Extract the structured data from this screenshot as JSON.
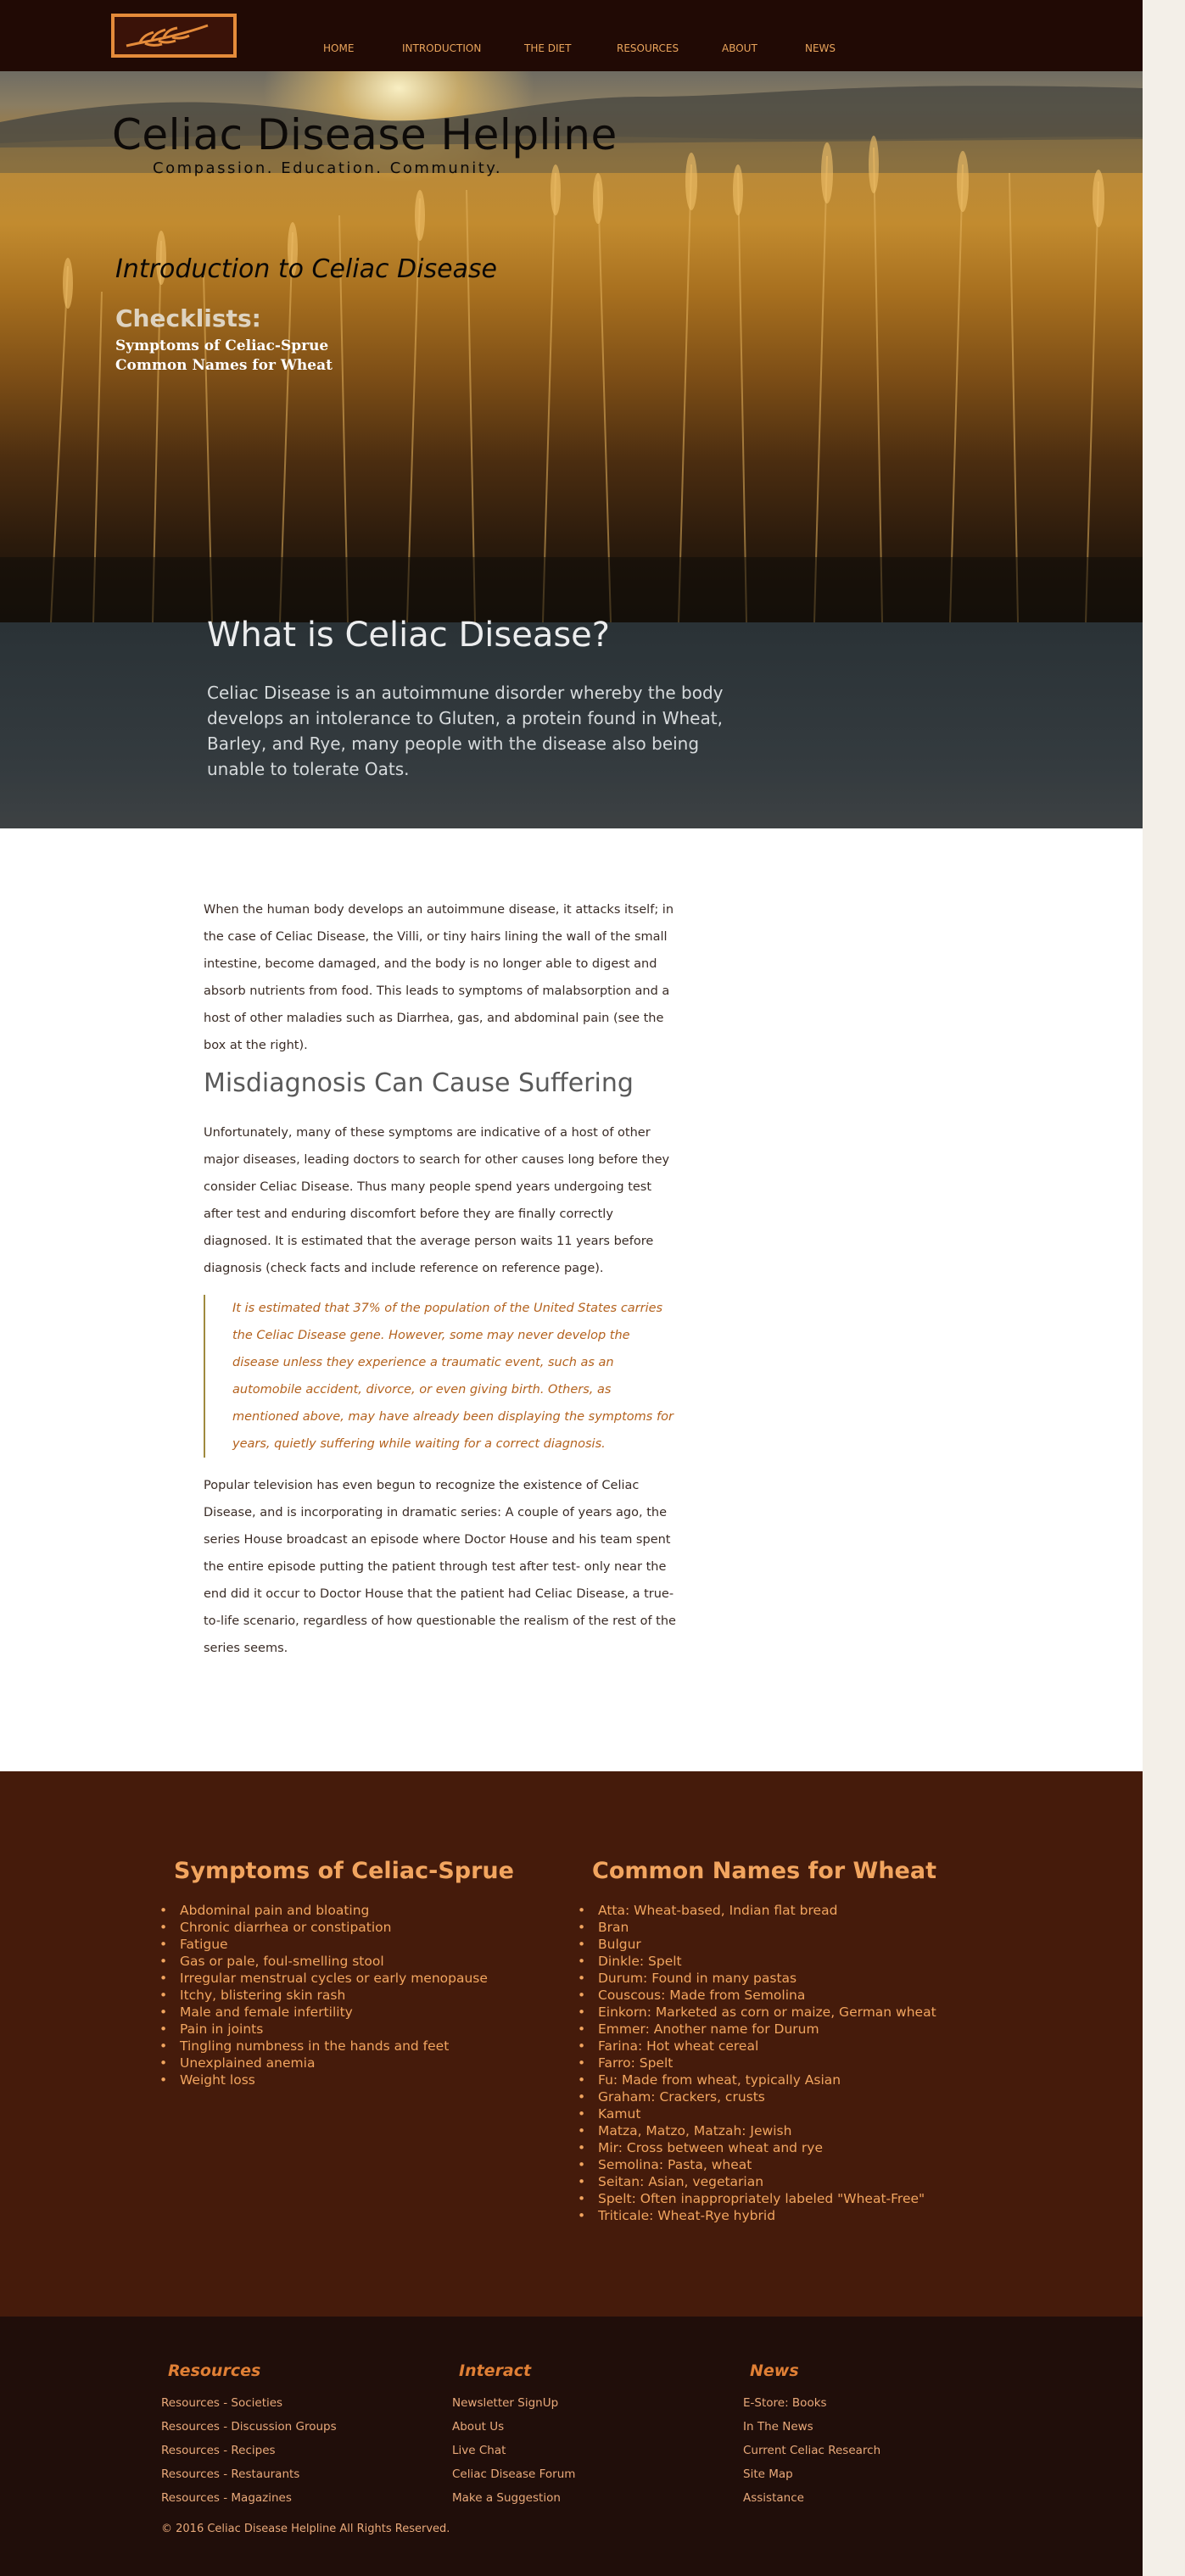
{
  "nav": {
    "items": [
      "HOME",
      "INTRODUCTION",
      "THE DIET",
      "RESOURCES",
      "ABOUT",
      "NEWS"
    ]
  },
  "hero": {
    "title": "Celiac Disease Helpline",
    "tagline": "Compassion. Education. Community.",
    "intro_link": "Introduction to Celiac Disease",
    "checklists_heading": "Checklists:",
    "checklist_links": [
      "Symptoms of Celiac-Sprue",
      "Common Names for Wheat"
    ]
  },
  "whatis": {
    "heading": "What is Celiac Disease?",
    "body": "Celiac Disease is an autoimmune disorder whereby the body develops an intolerance to Gluten, a protein found in Wheat, Barley, and Rye, many people with the disease also being unable to tolerate Oats."
  },
  "article": {
    "para1": "When the human body develops an autoimmune disease, it attacks itself; in the case of Celiac Disease, the Villi, or tiny hairs lining the wall of the small intestine, become damaged, and the body is no longer able to digest and absorb nutrients from food. This leads to symptoms of malabsorption and a host of other maladies such as Diarrhea, gas, and abdominal pain (see the box at the right).",
    "subheading": "Misdiagnosis Can Cause Suffering",
    "para2": "Unfortunately, many of these symptoms are indicative of a host of other major diseases, leading doctors to search for other causes long before they consider Celiac Disease. Thus many people spend years undergoing test after test and enduring discomfort before they are finally correctly diagnosed. It is estimated that the average person waits 11 years before diagnosis (check facts and include reference on reference page).",
    "quote": "It is estimated that 37% of the population of the United States carries the Celiac Disease gene. However, some may never develop the disease unless they experience a traumatic event, such as an automobile accident, divorce, or even giving birth. Others, as mentioned above, may have already been displaying the symptoms for years, quietly suffering while waiting for a correct diagnosis.",
    "para3": "Popular television has even begun to recognize the existence of Celiac Disease, and is incorporating in dramatic series: A couple of years ago, the series House broadcast an episode where Doctor House and his team spent the entire episode putting the patient through test after test- only near the end did it occur to Doctor House that the patient had Celiac Disease, a true-to-life scenario, regardless of how questionable the realism of the rest of the series seems."
  },
  "symptoms": {
    "title": "Symptoms of Celiac-Sprue",
    "items": [
      "Abdominal pain and bloating",
      "Chronic diarrhea or constipation",
      "Fatigue",
      "Gas or pale, foul-smelling stool",
      "Irregular menstrual cycles or early menopause",
      "Itchy, blistering skin rash",
      "Male and female infertility",
      "Pain in joints",
      "Tingling numbness in the hands and feet",
      "Unexplained anemia",
      "Weight loss"
    ]
  },
  "wheat": {
    "title": "Common Names for Wheat",
    "items": [
      "Atta: Wheat-based, Indian flat bread",
      "Bran",
      "Bulgur",
      "Dinkle: Spelt",
      "Durum: Found in many pastas",
      "Couscous: Made from Semolina",
      "Einkorn: Marketed as corn or maize, German wheat",
      "Emmer: Another name for Durum",
      "Farina: Hot wheat cereal",
      "Farro: Spelt",
      "Fu: Made from wheat, typically Asian",
      "Graham: Crackers, crusts",
      "Kamut",
      "Matza, Matzo, Matzah: Jewish",
      "Mir: Cross between wheat and rye",
      "Semolina: Pasta, wheat",
      "Seitan: Asian, vegetarian",
      "Spelt: Often inappropriately labeled \"Wheat-Free\"",
      "Triticale: Wheat-Rye hybrid"
    ]
  },
  "footer": {
    "columns": [
      {
        "heading": "Resources",
        "links": [
          "Resources - Societies",
          "Resources - Discussion Groups",
          "Resources - Recipes",
          "Resources - Restaurants",
          "Resources - Magazines"
        ]
      },
      {
        "heading": "Interact",
        "links": [
          "Newsletter SignUp",
          "About Us",
          "Live Chat",
          "Celiac Disease Forum",
          "Make a Suggestion"
        ]
      },
      {
        "heading": "News",
        "links": [
          "E-Store: Books",
          "In The News",
          "Current Celiac Research",
          "Site Map",
          "Assistance"
        ]
      }
    ],
    "copyright": "© 2016 Celiac Disease Helpline All Rights Reserved."
  },
  "colors": {
    "nav_bg": "#210a05",
    "accent_orange": "#e58b3a",
    "list_section_bg": "#451b0b",
    "footer_bg": "#200e0a",
    "quote_text": "#b4621e"
  }
}
